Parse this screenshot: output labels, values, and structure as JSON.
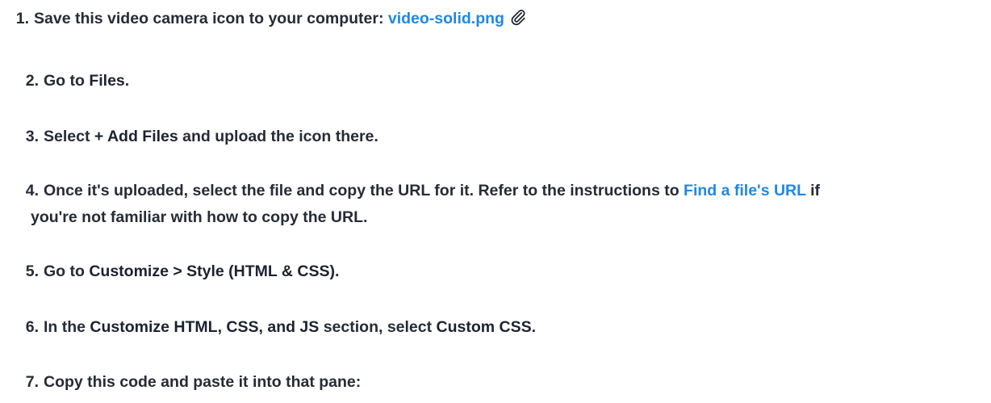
{
  "steps": [
    {
      "num": "1.",
      "before": "Save this video camera icon to your computer: ",
      "link": "video-solid.png",
      "icon": "paperclip-icon"
    },
    {
      "num": "2.",
      "before": "Go to ",
      "bold": "Files",
      "after": "."
    },
    {
      "num": "3.",
      "before": "Select ",
      "bold": "+ Add Files",
      "after": " and upload the icon there."
    },
    {
      "num": "4.",
      "before": "Once it's uploaded, select the file and copy the URL for it. Refer to the instructions to ",
      "link": "Find a file's URL",
      "after": " if",
      "line2": "you're not familiar with how to copy the URL."
    },
    {
      "num": "5.",
      "before": "Go to ",
      "bold": "Customize > Style (HTML & CSS)",
      "after": "."
    },
    {
      "num": "6.",
      "before": "In the ",
      "bold": "Customize HTML, CSS, and JS",
      "middle": " section, select ",
      "bold2": "Custom CSS",
      "after": "."
    },
    {
      "num": "7.",
      "before": "Copy this code and paste it into that pane:"
    }
  ],
  "colors": {
    "link": "#1e88e5",
    "text": "#262b36"
  }
}
